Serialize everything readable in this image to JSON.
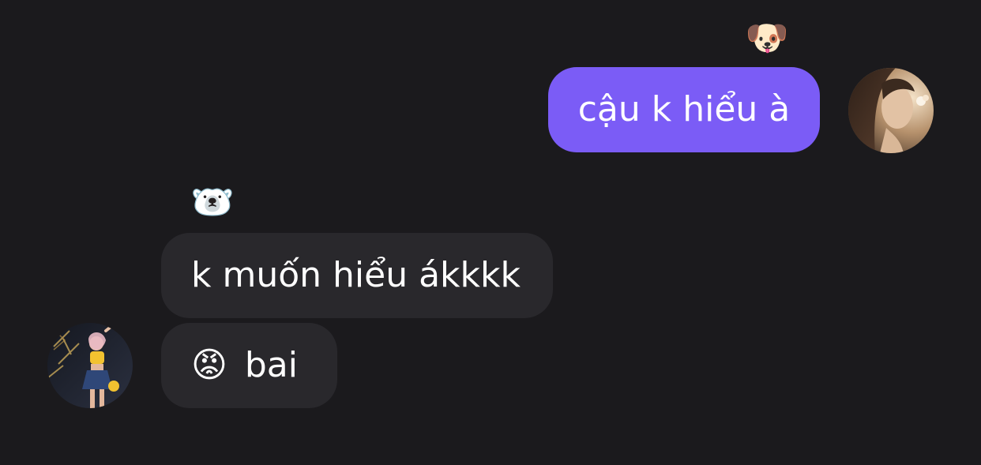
{
  "chat": {
    "messages": [
      {
        "sender": "self",
        "text": "cậu k hiểu à",
        "reaction_emoji": "🐶",
        "reaction_name": "dog-face"
      },
      {
        "sender": "other",
        "text": "k muốn hiểu ákkkk",
        "reaction_emoji": "🐻‍❄️",
        "reaction_name": "polar-bear"
      },
      {
        "sender": "other",
        "emoji": "😡",
        "emoji_name": "angry-face",
        "text": "bai"
      }
    ]
  },
  "colors": {
    "background": "#1b1a1d",
    "sent_bubble": "#7b5cf6",
    "received_bubble": "#29282c",
    "text": "#ffffff"
  }
}
